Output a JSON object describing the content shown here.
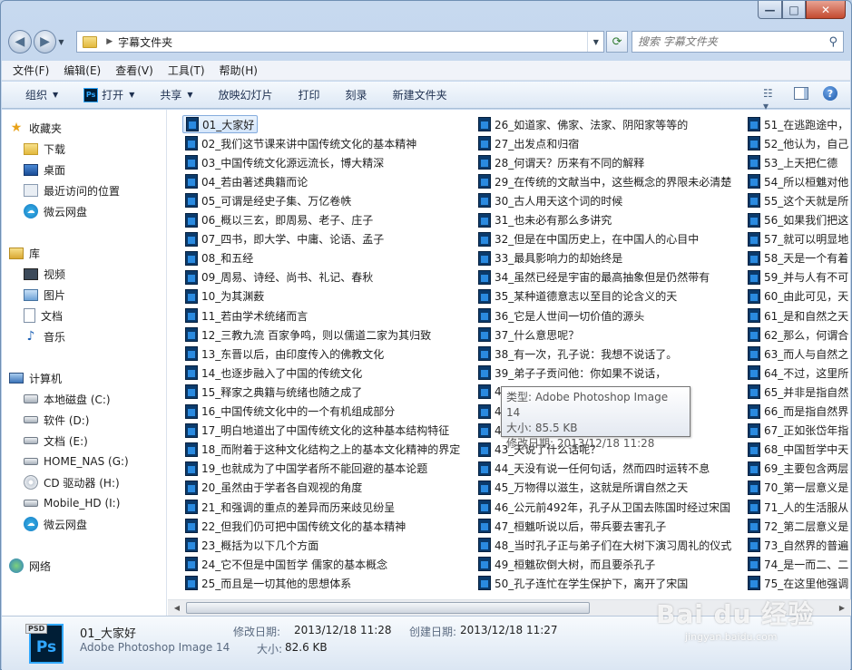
{
  "window": {
    "min": "—",
    "max": "□",
    "close": "✕"
  },
  "address": {
    "path": "字幕文件夹",
    "search_placeholder": "搜索 字幕文件夹"
  },
  "menu": [
    "文件(F)",
    "编辑(E)",
    "查看(V)",
    "工具(T)",
    "帮助(H)"
  ],
  "toolbar": {
    "organize": "组织",
    "open": "打开",
    "share": "共享",
    "slideshow": "放映幻灯片",
    "print": "打印",
    "burn": "刻录",
    "new_folder": "新建文件夹"
  },
  "nav": {
    "favorites": "收藏夹",
    "favorites_items": [
      "下载",
      "桌面",
      "最近访问的位置",
      "微云网盘"
    ],
    "libraries": "库",
    "library_items": [
      "视频",
      "图片",
      "文档",
      "音乐"
    ],
    "computer": "计算机",
    "computer_items": [
      "本地磁盘 (C:)",
      "软件 (D:)",
      "文档 (E:)",
      "HOME_NAS (G:)",
      "CD 驱动器 (H:)",
      "Mobile_HD (I:)",
      "微云网盘"
    ],
    "network": "网络"
  },
  "files": {
    "col1": [
      "01_大家好",
      "02_我们这节课来讲中国传统文化的基本精神",
      "03_中国传统文化源远流长，博大精深",
      "04_若由著述典籍而论",
      "05_可谓是经史子集、万亿卷帙",
      "06_概以三玄，即周易、老子、庄子",
      "07_四书，即大学、中庸、论语、孟子",
      "08_和五经",
      "09_周易、诗经、尚书、礼记、春秋",
      "10_为其渊薮",
      "11_若由学术统绪而言",
      "12_三教九流 百家争鸣，则以儒道二家为其归致",
      "13_东晋以后，由印度传入的佛教文化",
      "14_也逐步融入了中国的传统文化",
      "15_释家之典籍与统绪也随之成了",
      "16_中国传统文化中的一个有机组成部分",
      "17_明白地道出了中国传统文化的这种基本结构特征",
      "18_而附着于这种文化结构之上的基本文化精神的界定",
      "19_也就成为了中国学者所不能回避的基本论题",
      "20_虽然由于学者各自观视的角度",
      "21_和强调的重点的差异而历来歧见纷呈",
      "22_但我们仍可把中国传统文化的基本精神",
      "23_概括为以下几个方面",
      "24_它不但是中国哲学 儒家的基本概念",
      "25_而且是一切其他的思想体系"
    ],
    "col2": [
      "26_如道家、佛家、法家、阴阳家等等的",
      "27_出发点和归宿",
      "28_何谓天？历来有不同的解释",
      "29_在传统的文献当中，这些概念的界限未必清楚",
      "30_古人用天这个词的时候",
      "31_也未必有那么多讲究",
      "32_但是在中国历史上，在中国人的心目中",
      "33_最具影响力的却始终是",
      "34_虽然已经是宇宙的最高抽象但是仍然带有",
      "35_某种道德意志以至目的论含义的天",
      "36_它是人世间一切价值的源头",
      "37_什么意思呢？",
      "38_有一次，孔子说：我想不说话了。",
      "39_弟子子贡问他：你如果不说话，",
      "40_",
      "41_",
      "42_",
      "43_天说了什么话呢？",
      "44_天没有说一任何句话，然而四时运转不息",
      "45_万物得以滋生，这就是所谓自然之天",
      "46_公元前492年，孔子从卫国去陈国时经过宋国",
      "47_桓魋听说以后，带兵要去害孔子",
      "48_当时孔子正与弟子们在大树下演习周礼的仪式",
      "49_桓魋砍倒大树，而且要杀孔子",
      "50_孔子连忙在学生保护下，离开了宋国"
    ],
    "col3": [
      "51_在逃跑途中，",
      "52_他认为，自己",
      "53_上天把仁德",
      "54_所以桓魋对他",
      "55_这个天就是所",
      "56_如果我们把这",
      "57_就可以明显地",
      "58_天是一个有着",
      "59_并与人有不可",
      "60_由此可见，天",
      "61_是和自然之天",
      "62_那么，何谓合",
      "63_而人与自然之",
      "64_不过，这里所",
      "65_并非是指自然",
      "66_而是指自然界",
      "67_正如张岱年指",
      "68_中国哲学中天",
      "69_主要包含两层",
      "70_第一层意义是",
      "71_人的生活服从",
      "72_第二层意义是",
      "73_自然界的普遍",
      "74_是一而二、二",
      "75_在这里他强调"
    ]
  },
  "tooltip": {
    "type": "类型: Adobe Photoshop Image 14",
    "size": "大小: 85.5 KB",
    "modified": "修改日期: 2013/12/18 11:28"
  },
  "details": {
    "icon_tag": "PSD",
    "icon_text": "Ps",
    "name": "01_大家好",
    "type": "Adobe Photoshop Image 14",
    "modified_label": "修改日期:",
    "modified_value": "2013/12/18 11:28",
    "created_label": "创建日期:",
    "created_value": "2013/12/18 11:27",
    "size_label": "大小:",
    "size_value": "82.6 KB"
  },
  "watermark": {
    "main": "Bai du 经验",
    "sub": "jingyan.baidu.com"
  }
}
